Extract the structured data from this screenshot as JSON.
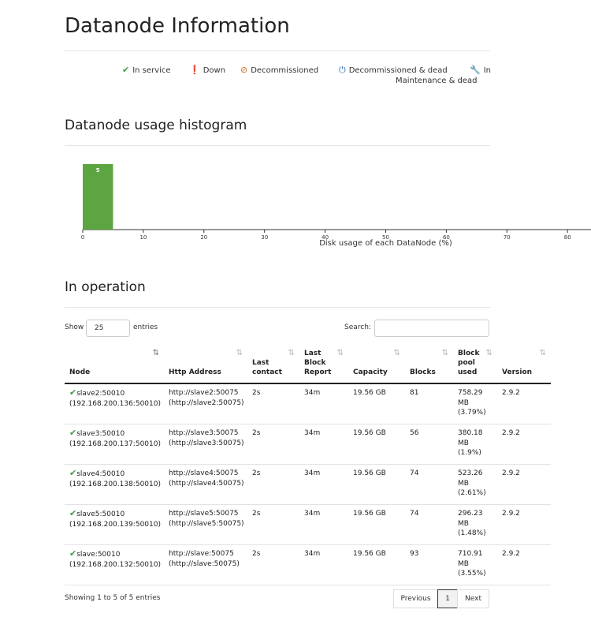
{
  "page_title": "Datanode Information",
  "legend": {
    "in_service": "In service",
    "down": "Down",
    "decommissioned": "Decommissioned",
    "decommissioned_dead": "Decommissioned & dead",
    "maintenance_line1": "In",
    "maintenance_line2": "Maintenance & dead",
    "colors": {
      "in_service": "#3f9d3f",
      "down": "#d0223b",
      "decommissioned": "#c8702a",
      "decommissioned_dead": "#2a6db0",
      "maintenance": "#e0892a"
    },
    "icons": {
      "in_service": "check-icon",
      "down": "exclamation-circle-icon",
      "decommissioned": "ban-icon",
      "decommissioned_dead": "power-icon",
      "maintenance": "wrench-icon"
    }
  },
  "histogram": {
    "heading": "Datanode usage histogram",
    "xlabel": "Disk usage of each DataNode (%)"
  },
  "chart_data": {
    "type": "bar",
    "title": "",
    "xlabel": "Disk usage of each DataNode (%)",
    "ylabel": "",
    "x_ticks": [
      0,
      10,
      20,
      30,
      40,
      50,
      60,
      70,
      80
    ],
    "bins": [
      {
        "from": 0,
        "to": 5,
        "value": 5
      }
    ],
    "bar_color": "#5da540",
    "xlim": [
      0,
      85
    ]
  },
  "operation": {
    "heading": "In operation",
    "show_label": "Show",
    "entries_value": "25",
    "entries_label": "entries",
    "search_label": "Search:",
    "search_value": "",
    "columns": [
      "Node",
      "Http Address",
      "Last contact",
      "Last Block Report",
      "Capacity",
      "Blocks",
      "Block pool used",
      "Version"
    ],
    "rows": [
      {
        "node": "slave2:50010",
        "node_ip": "(192.168.200.136:50010)",
        "http": "http://slave2:50075",
        "http2": "(http://slave2:50075)",
        "last_contact": "2s",
        "last_report": "34m",
        "capacity": "19.56 GB",
        "blocks": "81",
        "pool1": "758.29",
        "pool2": "MB",
        "pool3": "(3.79%)",
        "version": "2.9.2"
      },
      {
        "node": "slave3:50010",
        "node_ip": "(192.168.200.137:50010)",
        "http": "http://slave3:50075",
        "http2": "(http://slave3:50075)",
        "last_contact": "2s",
        "last_report": "34m",
        "capacity": "19.56 GB",
        "blocks": "56",
        "pool1": "380.18",
        "pool2": "MB",
        "pool3": "(1.9%)",
        "version": "2.9.2"
      },
      {
        "node": "slave4:50010",
        "node_ip": "(192.168.200.138:50010)",
        "http": "http://slave4:50075",
        "http2": "(http://slave4:50075)",
        "last_contact": "2s",
        "last_report": "34m",
        "capacity": "19.56 GB",
        "blocks": "74",
        "pool1": "523.26",
        "pool2": "MB",
        "pool3": "(2.61%)",
        "version": "2.9.2"
      },
      {
        "node": "slave5:50010",
        "node_ip": "(192.168.200.139:50010)",
        "http": "http://slave5:50075",
        "http2": "(http://slave5:50075)",
        "last_contact": "2s",
        "last_report": "34m",
        "capacity": "19.56 GB",
        "blocks": "74",
        "pool1": "296.23",
        "pool2": "MB",
        "pool3": "(1.48%)",
        "version": "2.9.2"
      },
      {
        "node": "slave:50010",
        "node_ip": "(192.168.200.132:50010)",
        "http": "http://slave:50075",
        "http2": "(http://slave:50075)",
        "last_contact": "2s",
        "last_report": "34m",
        "capacity": "19.56 GB",
        "blocks": "93",
        "pool1": "710.91",
        "pool2": "MB",
        "pool3": "(3.55%)",
        "version": "2.9.2"
      }
    ],
    "showing": "Showing 1 to 5 of 5 entries",
    "pagination": {
      "previous": "Previous",
      "current": "1",
      "next": "Next"
    }
  }
}
